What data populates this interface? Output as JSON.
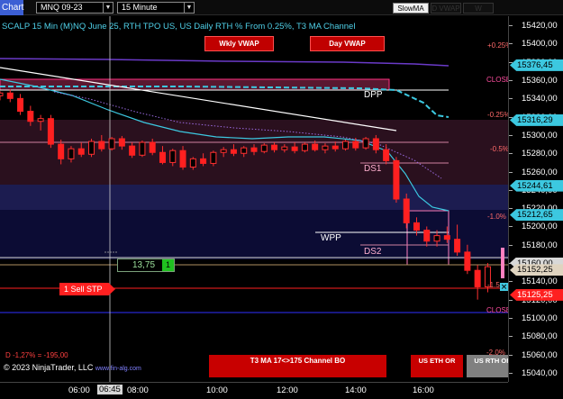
{
  "toolbar": {
    "title": "Chart",
    "instrument": "MNQ 09-23",
    "interval": "15 Minute",
    "buttons": [
      {
        "label": "SlowMA",
        "active": true
      },
      {
        "label": "D VWAP",
        "active": false
      },
      {
        "label": "W VWAP",
        "active": false
      }
    ]
  },
  "header": {
    "text": "SCALP 15 Min (M)NQ June 25, RTH TPO US, US Daily RTH % From 0.25%, T3 MA Channel"
  },
  "overlay_buttons": {
    "weekly_vwap": "Wkly VWAP",
    "day_vwap": "Day VWAP",
    "t3_channel": "T3 MA 17<>175 Channel BO",
    "us_eth_or": "US ETH OR",
    "us_rth_or": "US RTH OR"
  },
  "level_labels": {
    "pct_plus_025": "+0.25%",
    "close_top": "CLOSE",
    "pct_minus_025": "-0.25%",
    "pct_minus_05": "-0.5%",
    "pct_minus_1": "-1.0%",
    "pct_minus_15": "-1.5",
    "close_bottom": "CLOSE",
    "pct_minus_2": "-2.0%",
    "dpp": "DPP",
    "ds1": "DS1",
    "wpp": "WPP",
    "ds2": "DS2"
  },
  "order_panel": {
    "quantity": "13,75",
    "count": "1",
    "sell_stop_label": "1  Sell STP"
  },
  "pnl_text": "D -1,27% = -195,00",
  "copyright": "© 2023 NinjaTrader, LLC",
  "website": "www.fin-alg.com",
  "price_axis": {
    "ticks": [
      "15420,00",
      "15400,00",
      "15380,00",
      "15360,00",
      "15340,00",
      "15320,00",
      "15300,00",
      "15280,00",
      "15260,00",
      "15240,00",
      "15220,00",
      "15200,00",
      "15180,00",
      "15160,00",
      "15140,00",
      "15120,00",
      "15100,00",
      "15080,00",
      "15060,00",
      "15040,00"
    ],
    "tags": [
      {
        "label": "15376,45",
        "bg": "#3cc8e0",
        "fg": "#000"
      },
      {
        "label": "15316,29",
        "bg": "#3cc8e0",
        "fg": "#000"
      },
      {
        "label": "15244,61",
        "bg": "#3cc8e0",
        "fg": "#000"
      },
      {
        "label": "15212,65",
        "bg": "#3cc8e0",
        "fg": "#000"
      },
      {
        "label": "15160,00",
        "bg": "#d8d8d8",
        "fg": "#000"
      },
      {
        "label": "15152,25",
        "bg": "#e0d4c0",
        "fg": "#000"
      },
      {
        "label": "15125,25",
        "bg": "#ff2020",
        "fg": "#fff"
      }
    ]
  },
  "time_axis": {
    "labels": [
      "06:00",
      "06:45",
      "08:00",
      "10:00",
      "12:00",
      "14:00",
      "16:00"
    ],
    "highlight": "06:45"
  },
  "colors": {
    "accent_cyan": "#4fd0e8",
    "up_candle": "#ffffff",
    "down_candle": "#ff2020",
    "sell_stop": "#ff2020",
    "channel_fill": "#28285a"
  },
  "chart_data": {
    "type": "candlestick",
    "ylim": [
      15030,
      15430
    ],
    "x_range": [
      "04:45",
      "17:15"
    ],
    "candles": [
      {
        "t": "04:00",
        "o": 15354,
        "h": 15358,
        "l": 15348,
        "c": 15352
      },
      {
        "t": "04:15",
        "o": 15352,
        "h": 15355,
        "l": 15346,
        "c": 15348
      },
      {
        "t": "04:30",
        "o": 15348,
        "h": 15352,
        "l": 15340,
        "c": 15343
      },
      {
        "t": "04:45",
        "o": 15343,
        "h": 15348,
        "l": 15338,
        "c": 15346
      },
      {
        "t": "05:00",
        "o": 15346,
        "h": 15350,
        "l": 15336,
        "c": 15340
      },
      {
        "t": "05:15",
        "o": 15340,
        "h": 15345,
        "l": 15322,
        "c": 15326
      },
      {
        "t": "05:30",
        "o": 15326,
        "h": 15332,
        "l": 15310,
        "c": 15315
      },
      {
        "t": "05:45",
        "o": 15315,
        "h": 15322,
        "l": 15305,
        "c": 15318
      },
      {
        "t": "06:00",
        "o": 15318,
        "h": 15322,
        "l": 15286,
        "c": 15290
      },
      {
        "t": "06:15",
        "o": 15290,
        "h": 15295,
        "l": 15268,
        "c": 15274
      },
      {
        "t": "06:30",
        "o": 15274,
        "h": 15288,
        "l": 15270,
        "c": 15285
      },
      {
        "t": "06:45",
        "o": 15285,
        "h": 15292,
        "l": 15276,
        "c": 15279
      },
      {
        "t": "07:00",
        "o": 15279,
        "h": 15296,
        "l": 15276,
        "c": 15293
      },
      {
        "t": "07:15",
        "o": 15293,
        "h": 15300,
        "l": 15282,
        "c": 15285
      },
      {
        "t": "07:30",
        "o": 15285,
        "h": 15298,
        "l": 15283,
        "c": 15296
      },
      {
        "t": "07:45",
        "o": 15296,
        "h": 15299,
        "l": 15284,
        "c": 15288
      },
      {
        "t": "08:00",
        "o": 15288,
        "h": 15292,
        "l": 15275,
        "c": 15278
      },
      {
        "t": "08:15",
        "o": 15278,
        "h": 15294,
        "l": 15276,
        "c": 15292
      },
      {
        "t": "08:30",
        "o": 15292,
        "h": 15296,
        "l": 15278,
        "c": 15281
      },
      {
        "t": "08:45",
        "o": 15281,
        "h": 15288,
        "l": 15268,
        "c": 15270
      },
      {
        "t": "09:00",
        "o": 15270,
        "h": 15285,
        "l": 15266,
        "c": 15283
      },
      {
        "t": "09:15",
        "o": 15283,
        "h": 15288,
        "l": 15262,
        "c": 15265
      },
      {
        "t": "09:30",
        "o": 15265,
        "h": 15276,
        "l": 15262,
        "c": 15274
      },
      {
        "t": "09:45",
        "o": 15274,
        "h": 15280,
        "l": 15266,
        "c": 15269
      },
      {
        "t": "10:00",
        "o": 15269,
        "h": 15283,
        "l": 15266,
        "c": 15281
      },
      {
        "t": "10:15",
        "o": 15281,
        "h": 15287,
        "l": 15276,
        "c": 15284
      },
      {
        "t": "10:30",
        "o": 15284,
        "h": 15290,
        "l": 15277,
        "c": 15280
      },
      {
        "t": "10:45",
        "o": 15280,
        "h": 15288,
        "l": 15276,
        "c": 15286
      },
      {
        "t": "11:00",
        "o": 15286,
        "h": 15290,
        "l": 15278,
        "c": 15282
      },
      {
        "t": "11:15",
        "o": 15282,
        "h": 15291,
        "l": 15280,
        "c": 15289
      },
      {
        "t": "11:30",
        "o": 15289,
        "h": 15292,
        "l": 15281,
        "c": 15284
      },
      {
        "t": "11:45",
        "o": 15284,
        "h": 15290,
        "l": 15281,
        "c": 15287
      },
      {
        "t": "12:00",
        "o": 15287,
        "h": 15292,
        "l": 15280,
        "c": 15283
      },
      {
        "t": "12:15",
        "o": 15283,
        "h": 15292,
        "l": 15281,
        "c": 15290
      },
      {
        "t": "12:30",
        "o": 15290,
        "h": 15294,
        "l": 15282,
        "c": 15284
      },
      {
        "t": "12:45",
        "o": 15284,
        "h": 15291,
        "l": 15280,
        "c": 15288
      },
      {
        "t": "13:00",
        "o": 15288,
        "h": 15293,
        "l": 15282,
        "c": 15285
      },
      {
        "t": "13:15",
        "o": 15285,
        "h": 15295,
        "l": 15283,
        "c": 15293
      },
      {
        "t": "13:30",
        "o": 15293,
        "h": 15297,
        "l": 15283,
        "c": 15286
      },
      {
        "t": "13:45",
        "o": 15286,
        "h": 15298,
        "l": 15284,
        "c": 15296
      },
      {
        "t": "14:00",
        "o": 15296,
        "h": 15300,
        "l": 15280,
        "c": 15284
      },
      {
        "t": "14:15",
        "o": 15284,
        "h": 15290,
        "l": 15268,
        "c": 15272
      },
      {
        "t": "14:30",
        "o": 15272,
        "h": 15276,
        "l": 15226,
        "c": 15230
      },
      {
        "t": "14:45",
        "o": 15230,
        "h": 15236,
        "l": 15198,
        "c": 15204
      },
      {
        "t": "15:00",
        "o": 15204,
        "h": 15210,
        "l": 15190,
        "c": 15196
      },
      {
        "t": "15:15",
        "o": 15196,
        "h": 15200,
        "l": 15178,
        "c": 15184
      },
      {
        "t": "15:30",
        "o": 15184,
        "h": 15196,
        "l": 15178,
        "c": 15190
      },
      {
        "t": "15:45",
        "o": 15190,
        "h": 15200,
        "l": 15182,
        "c": 15186
      },
      {
        "t": "16:00",
        "o": 15186,
        "h": 15202,
        "l": 15168,
        "c": 15172
      },
      {
        "t": "16:15",
        "o": 15172,
        "h": 15180,
        "l": 15148,
        "c": 15152
      },
      {
        "t": "16:30",
        "o": 15152,
        "h": 15158,
        "l": 15120,
        "c": 15134
      },
      {
        "t": "16:45",
        "o": 15134,
        "h": 15160,
        "l": 15128,
        "c": 15156
      }
    ]
  }
}
